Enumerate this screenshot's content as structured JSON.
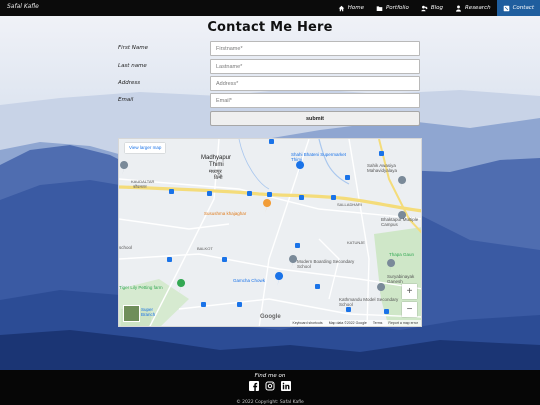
{
  "navbar": {
    "brand": "Safal Kafle",
    "items": [
      {
        "label": "Home",
        "icon": "home-icon",
        "active": false
      },
      {
        "label": "Portfolio",
        "icon": "folder-icon",
        "active": false
      },
      {
        "label": "Blog",
        "icon": "blog-icon",
        "active": false
      },
      {
        "label": "Research",
        "icon": "person-icon",
        "active": false
      },
      {
        "label": "Contact",
        "icon": "contact-icon",
        "active": true
      }
    ]
  },
  "page": {
    "title": "Contact Me Here"
  },
  "form": {
    "first_name": {
      "label": "First Name",
      "placeholder": "Firstname*"
    },
    "last_name": {
      "label": "Last name",
      "placeholder": "Lastname*"
    },
    "address": {
      "label": "Address",
      "placeholder": "Address*"
    },
    "email": {
      "label": "Email",
      "placeholder": "Email*"
    },
    "submit_label": "submit"
  },
  "map": {
    "view_larger": "View larger map",
    "zoom_in": "+",
    "zoom_out": "−",
    "google": "Google",
    "footer": [
      "Keyboard shortcuts",
      "Map data ©2022 Google",
      "Terms",
      "Report a map error"
    ],
    "places": {
      "madhyapur": "Madhyapur",
      "thimi": "Thimi",
      "madhyapur_dev": "मध्यपुर",
      "thimi_dev": "ठिमी",
      "kaudaltar": "KAUDALTAR",
      "kaudaltar_dev": "कौडलटार",
      "salladhari": "SALLADHARI",
      "balkot": "BALKOT",
      "katunje": "KATUNJE",
      "bhaktapur_multiple": "Bhaktapur Multiple Campus",
      "shahi_bhateni": "Shahi Bhateni Supermarket Thimi",
      "sahik": "Sahik Awasiya Mahavidyalaya",
      "sushma": "Susushma khajaghar",
      "modern": "Modern Boarding Secondary School",
      "thapa": "Thapa Gaun",
      "suryabinayak": "Suryabinayak Ganesh",
      "gamcha": "Gamcha Chowk",
      "tiger": "Tiger Lily Petting farm",
      "kathmandu_model": "Kathmandu Model Secondary School",
      "super": "Super Branch",
      "school": "school"
    }
  },
  "footer": {
    "find_me": "Find me on",
    "socials": [
      "facebook-icon",
      "instagram-icon",
      "linkedin-icon"
    ],
    "copyright": "© 2022 Copyright: Safal Kafle"
  },
  "colors": {
    "nav_bg": "#0b0b0b",
    "active_nav": "#1f5e9e",
    "footer_bg": "#060606",
    "mountain_dark": "#1b3574",
    "mountain_mid": "#2c4c95"
  }
}
